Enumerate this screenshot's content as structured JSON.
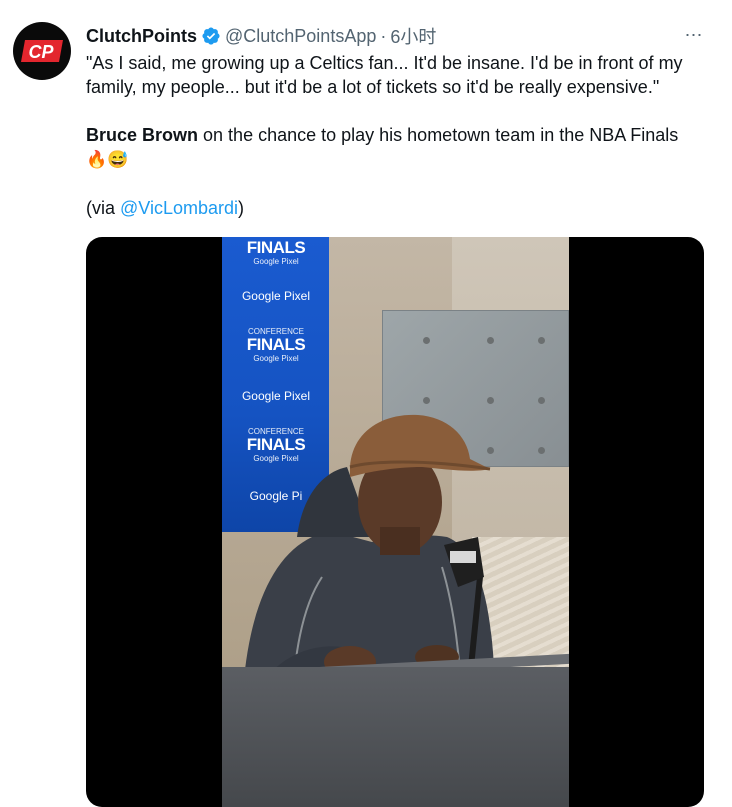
{
  "tweet": {
    "author_name": "ClutchPoints",
    "avatar_text": "CP",
    "handle": "@ClutchPointsApp",
    "separator": "·",
    "timestamp": "6小时",
    "more_icon": "⋯",
    "quote_text": "\"As I said, me growing up a Celtics fan... It'd be insane. I'd be in front of my family, my people... but it'd be a lot of tickets so it'd be really expensive.\"",
    "subject_name": "Bruce Brown",
    "subject_rest": " on the chance to play his hometown team in the NBA Finals",
    "emojis": "🔥😅",
    "via_open": "(via ",
    "via_mention": "@VicLombardi",
    "via_close": ")"
  },
  "video": {
    "backdrop_items": [
      {
        "kind": "finals",
        "label": "FINALS",
        "sub": "Google Pixel"
      },
      {
        "kind": "pixel",
        "label": "Google Pixel"
      },
      {
        "kind": "finals",
        "small": "CONFERENCE",
        "label": "FINALS",
        "sub": "Google Pixel"
      },
      {
        "kind": "pixel",
        "label": "Google Pixel"
      },
      {
        "kind": "finals",
        "small": "CONFERENCE",
        "label": "FINALS",
        "sub": "Google Pixel"
      },
      {
        "kind": "pixel",
        "label": "Google Pi"
      }
    ]
  },
  "colors": {
    "link": "#1d9bf0",
    "verified": "#1d9bf0",
    "muted": "#536471",
    "text": "#0f1419",
    "brand_red": "#e3262e"
  }
}
